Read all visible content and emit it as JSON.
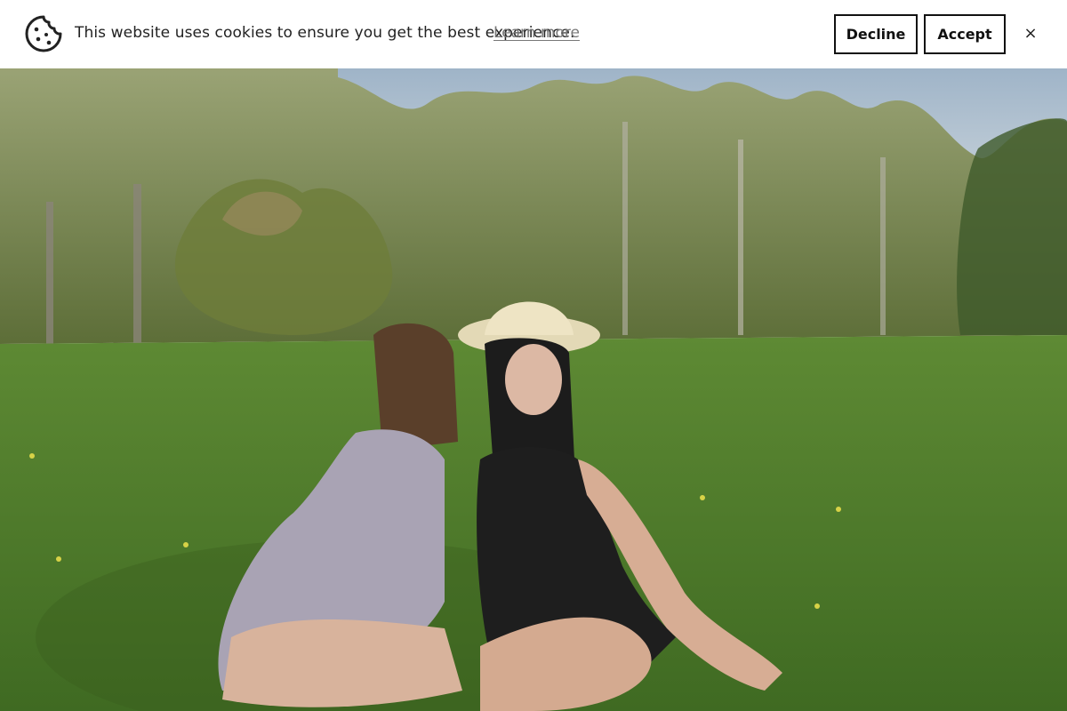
{
  "cookie_banner": {
    "message": "This website uses cookies to ensure you get the best experience.",
    "learn_more_label": "Learn more",
    "decline_label": "Decline",
    "accept_label": "Accept",
    "close_label": "×",
    "icon": "cookie-icon"
  },
  "hero": {
    "image_description": "",
    "colors": {
      "sky": "#a9bed0",
      "trees": "#7c8a55",
      "grass": "#4f7a2c",
      "accent_text": "#777777"
    }
  }
}
